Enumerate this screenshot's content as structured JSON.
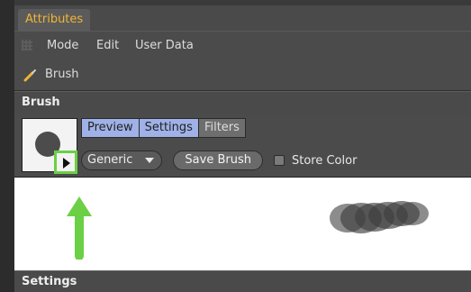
{
  "panel": {
    "tab_label": "Attributes"
  },
  "menu": {
    "items": [
      "Mode",
      "Edit",
      "User Data"
    ]
  },
  "object": {
    "label": "Brush"
  },
  "sections": {
    "brush_title": "Brush",
    "settings_title": "Settings"
  },
  "brush": {
    "tabs": [
      "Preview",
      "Settings",
      "Filters"
    ],
    "preset": "Generic",
    "save_button": "Save Brush",
    "store_color_label": "Store Color"
  },
  "icons": [
    "grip-icon",
    "brush-icon",
    "play-icon",
    "chevron-down-icon"
  ],
  "colors": {
    "accent": "#f1b437",
    "tab_active": "#9fb1e7",
    "highlight": "#6bd045"
  }
}
